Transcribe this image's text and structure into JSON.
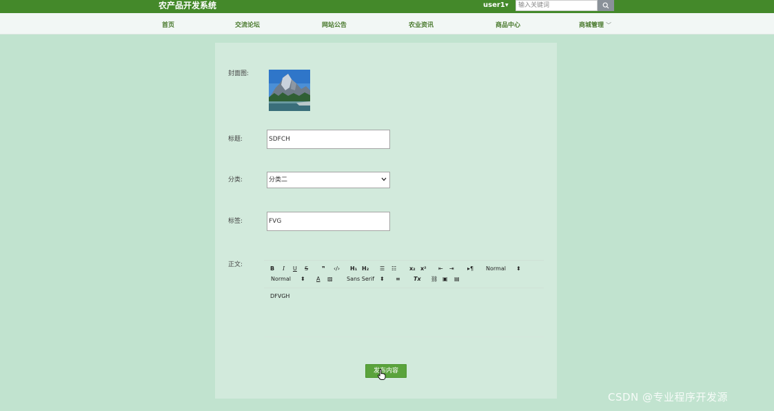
{
  "header": {
    "brand": "农产品开发系统",
    "username": "user1",
    "search_placeholder": "输入关键词"
  },
  "nav": {
    "items": [
      {
        "label": "首页"
      },
      {
        "label": "交流论坛"
      },
      {
        "label": "网站公告"
      },
      {
        "label": "农业资讯"
      },
      {
        "label": "商品中心"
      },
      {
        "label": "商城管理"
      }
    ]
  },
  "form": {
    "cover_label": "封面图:",
    "title_label": "标题:",
    "title_value": "SDFCH",
    "category_label": "分类:",
    "category_value": "分类二",
    "tags_label": "标签:",
    "tags_value": "FVG",
    "content_label": "正文:",
    "content_value": "DFVGH",
    "submit_label": "发布内容"
  },
  "editor_toolbar": {
    "header_select": "Normal",
    "size_select": "Normal",
    "font_select": "Sans Serif"
  },
  "watermark": "CSDN @专业程序开发源",
  "icons": {
    "search": "search-icon",
    "caret": "caret-down-icon",
    "chevron": "chevron-down-icon",
    "cursor": "hand-pointer-icon"
  },
  "colors": {
    "header_bg": "#44892a",
    "page_bg": "#c1e3cf",
    "panel_bg": "#d2eadc",
    "nav_text": "#4a7a2e",
    "button_bg": "#5aa33c"
  }
}
